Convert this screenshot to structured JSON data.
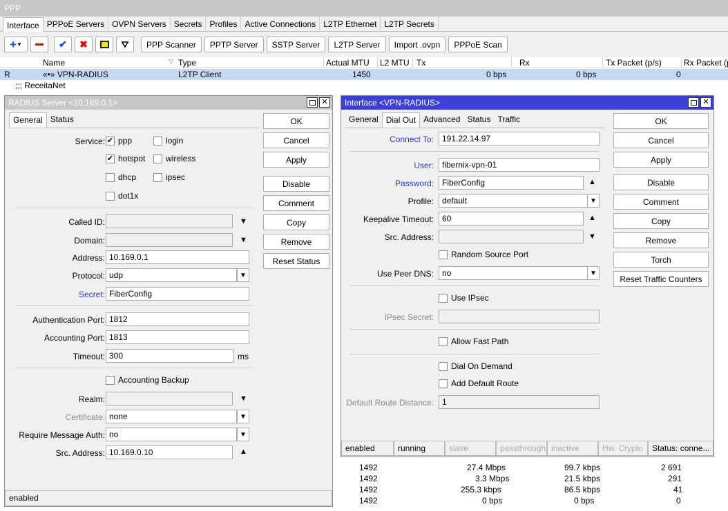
{
  "main": {
    "title": "PPP",
    "tabs": [
      "Interface",
      "PPPoE Servers",
      "OVPN Servers",
      "Secrets",
      "Profiles",
      "Active Connections",
      "L2TP Ethernet",
      "L2TP Secrets"
    ],
    "toolbar": [
      "PPP Scanner",
      "PPTP Server",
      "SSTP Server",
      "L2TP Server",
      "Import .ovpn",
      "PPPoE Scan"
    ],
    "columns": {
      "name": "Name",
      "type": "Type",
      "actual_mtu": "Actual MTU",
      "l2mtu": "L2 MTU",
      "tx": "Tx",
      "rx": "Rx",
      "tx_packet": "Tx Packet (p/s)",
      "rx_packet": "Rx Packet (p"
    },
    "selected_row": {
      "flag": "R",
      "name": "«•» VPN-RADIUS",
      "type": "L2TP Client",
      "mtu": "1450",
      "tx": "0 bps",
      "rx": "0 bps",
      "tx_packet": "0"
    },
    "comment_row": ";;; ReceitaNet",
    "rows": [
      {
        "mtu": "1492",
        "tx": "27.4 Mbps",
        "rx": "99.7 kbps",
        "txp": "2 691"
      },
      {
        "mtu": "1492",
        "tx": "3.3 Mbps",
        "rx": "21.5 kbps",
        "txp": "291"
      },
      {
        "mtu": "1492",
        "tx": "255.3 kbps",
        "rx": "86.5 kbps",
        "txp": "41"
      },
      {
        "mtu": "1492",
        "tx": "0 bps",
        "rx": "0 bps",
        "txp": "0"
      }
    ]
  },
  "radius": {
    "title": "RADIUS Server <10.169.0.1>",
    "tabs": [
      "General",
      "Status"
    ],
    "service_label": "Service:",
    "services": [
      {
        "label": "ppp",
        "checked": true
      },
      {
        "label": "login",
        "checked": false
      },
      {
        "label": "hotspot",
        "checked": true
      },
      {
        "label": "wireless",
        "checked": false
      },
      {
        "label": "dhcp",
        "checked": false
      },
      {
        "label": "ipsec",
        "checked": false
      },
      {
        "label": "dot1x",
        "checked": false
      }
    ],
    "labels": {
      "called_id": "Called ID:",
      "domain": "Domain:",
      "address": "Address:",
      "protocol": "Protocol:",
      "secret": "Secret:",
      "auth_port": "Authentication Port:",
      "acct_port": "Accounting Port:",
      "timeout": "Timeout:",
      "realm": "Realm:",
      "certificate": "Certificate:",
      "require_msg_auth": "Require Message Auth:",
      "src_address": "Src. Address:"
    },
    "values": {
      "address": "10.169.0.1",
      "protocol": "udp",
      "secret": "FiberConfig",
      "auth_port": "1812",
      "acct_port": "1813",
      "timeout": "300",
      "timeout_unit": "ms",
      "certificate": "none",
      "require_msg_auth": "no",
      "src_address": "10.169.0.10"
    },
    "accounting_backup": "Accounting Backup",
    "buttons": [
      "OK",
      "Cancel",
      "Apply",
      "Disable",
      "Comment",
      "Copy",
      "Remove",
      "Reset Status"
    ],
    "status": "enabled"
  },
  "iface": {
    "title": "Interface <VPN-RADIUS>",
    "tabs": [
      "General",
      "Dial Out",
      "Advanced",
      "Status",
      "Traffic"
    ],
    "labels": {
      "connect_to": "Connect To:",
      "user": "User:",
      "password": "Password:",
      "profile": "Profile:",
      "keepalive": "Keepalive Timeout:",
      "src_address": "Src. Address:",
      "use_peer_dns": "Use Peer DNS:",
      "ipsec_secret": "IPsec Secret:",
      "default_route_distance": "Default Route Distance:"
    },
    "values": {
      "connect_to": "191.22.14.97",
      "user": "fibernix-vpn-01",
      "password": "FiberConfig",
      "profile": "default",
      "keepalive": "60",
      "use_peer_dns": "no",
      "default_route_distance": "1"
    },
    "checks": {
      "random_source_port": "Random Source Port",
      "use_ipsec": "Use IPsec",
      "allow_fast_path": "Allow Fast Path",
      "dial_on_demand": "Dial On Demand",
      "add_default_route": "Add Default Route"
    },
    "buttons": [
      "OK",
      "Cancel",
      "Apply",
      "Disable",
      "Comment",
      "Copy",
      "Remove",
      "Torch",
      "Reset Traffic Counters"
    ],
    "status": [
      "enabled",
      "running",
      "slave",
      "passthrough",
      "inactive",
      "Hw. Crypto",
      "Status: conne..."
    ]
  }
}
